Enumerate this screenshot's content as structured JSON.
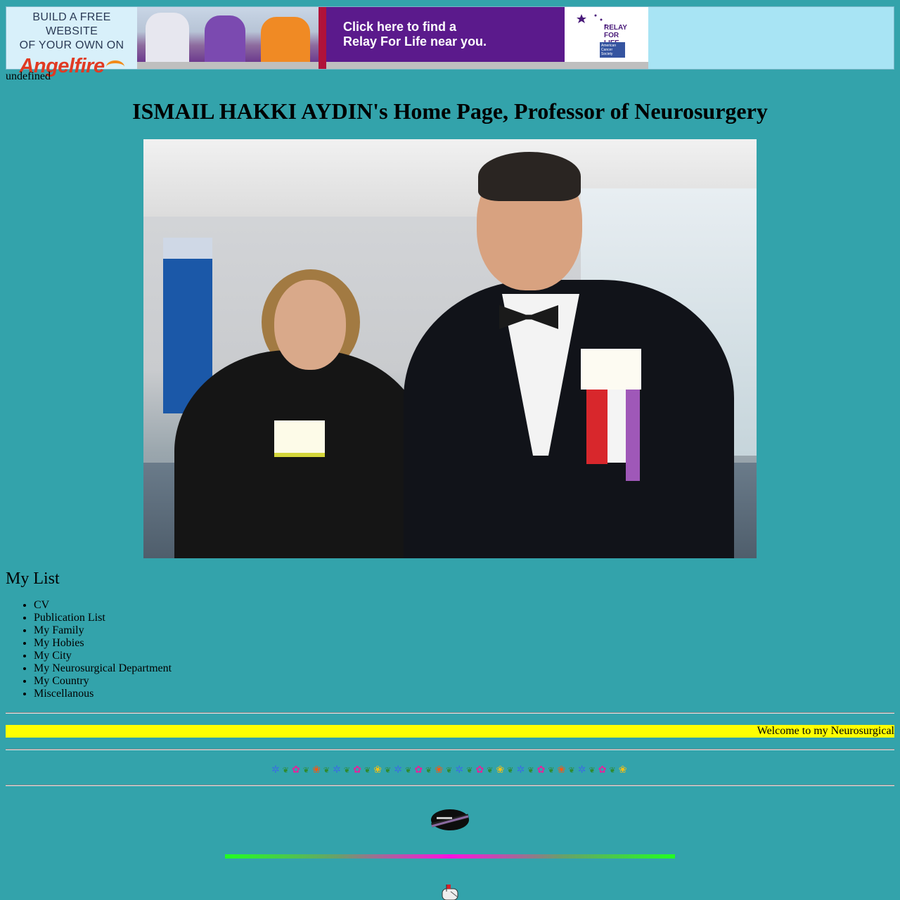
{
  "banner": {
    "angelfire_line1": "BUILD A FREE WEBSITE",
    "angelfire_line2": "OF YOUR OWN ON",
    "angelfire_brand": "Angelfire",
    "ad_line1": "Click here to find a",
    "ad_line2": "Relay For Life near you.",
    "relay_logo_text": "RELAY FOR LIFE",
    "acs_text": "American Cancer Society"
  },
  "undefined_text": "undefined",
  "page_title": "ISMAIL HAKKI AYDIN's Home Page, Professor of Neurosurgery",
  "list_heading": "My List",
  "links": [
    "CV",
    "Publication List",
    "My Family",
    "My Hobies",
    "My City",
    "My Neurosurgical Department",
    "My Country",
    "Miscellanous"
  ],
  "marquee_text": "Welcome to my Neurosurgical",
  "colors": {
    "background": "#33a3ab",
    "marquee_bg": "#ffff00",
    "banner_bg": "#a8e4f4",
    "ad_purple": "#5b1a8c"
  },
  "icons": {
    "flower_border": "flower-border-icon",
    "emblem": "black-cap-icon",
    "divider": "rainbow-divider-icon",
    "mail": "mailbox-icon"
  }
}
